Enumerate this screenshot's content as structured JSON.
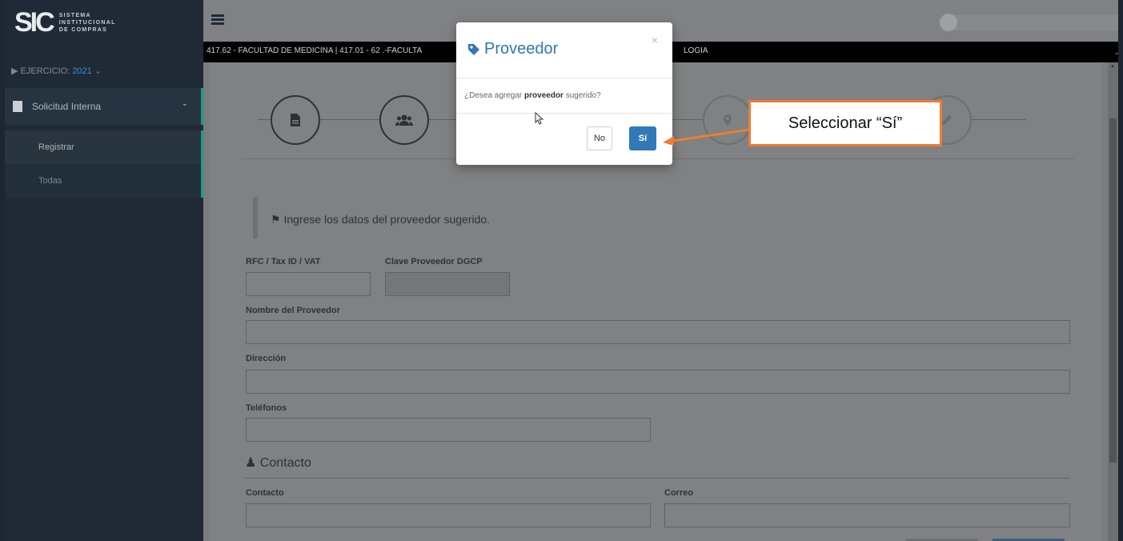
{
  "sidebar": {
    "logo_mark": "SIC",
    "logo_line1": "SISTEMA",
    "logo_line2": "INSTITUCIONAL",
    "logo_line3": "DE COMPRAS",
    "exercise_label": "▶ EJERCICIO:",
    "exercise_year": "2021 ⌄",
    "menu_title": "Solicitud Interna",
    "items": [
      {
        "label": "Registrar"
      },
      {
        "label": "Todas"
      }
    ]
  },
  "header": {
    "breadcrumb": "417.62 - FACULTAD DE MEDICINA | 417.01 - 62 .-FACULTA",
    "breadcrumb_tail": "LOGIA"
  },
  "form": {
    "info_text": "Ingrese los datos del proveedor sugerido.",
    "rfc_label": "RFC / Tax ID / VAT",
    "clave_label": "Clave Proveedor DGCP",
    "nombre_label": "Nombre del Proveedor",
    "direccion_label": "Dirección",
    "telefonos_label": "Teléfonos",
    "contact_section": "Contacto",
    "contacto_label": "Contacto",
    "correo_label": "Correo"
  },
  "modal": {
    "title": "Proveedor",
    "close": "×",
    "question_pre": "¿Desea agregar",
    "question_bold": "proveedor",
    "question_post": "sugerido?",
    "no_label": "No",
    "si_label": "Sí"
  },
  "callout": {
    "text": "Seleccionar “Sí”"
  },
  "colors": {
    "accent": "#3179b9",
    "callout_border": "#ed7d31",
    "sidebar_bg": "#1f2a36",
    "active_border": "#17a085"
  }
}
